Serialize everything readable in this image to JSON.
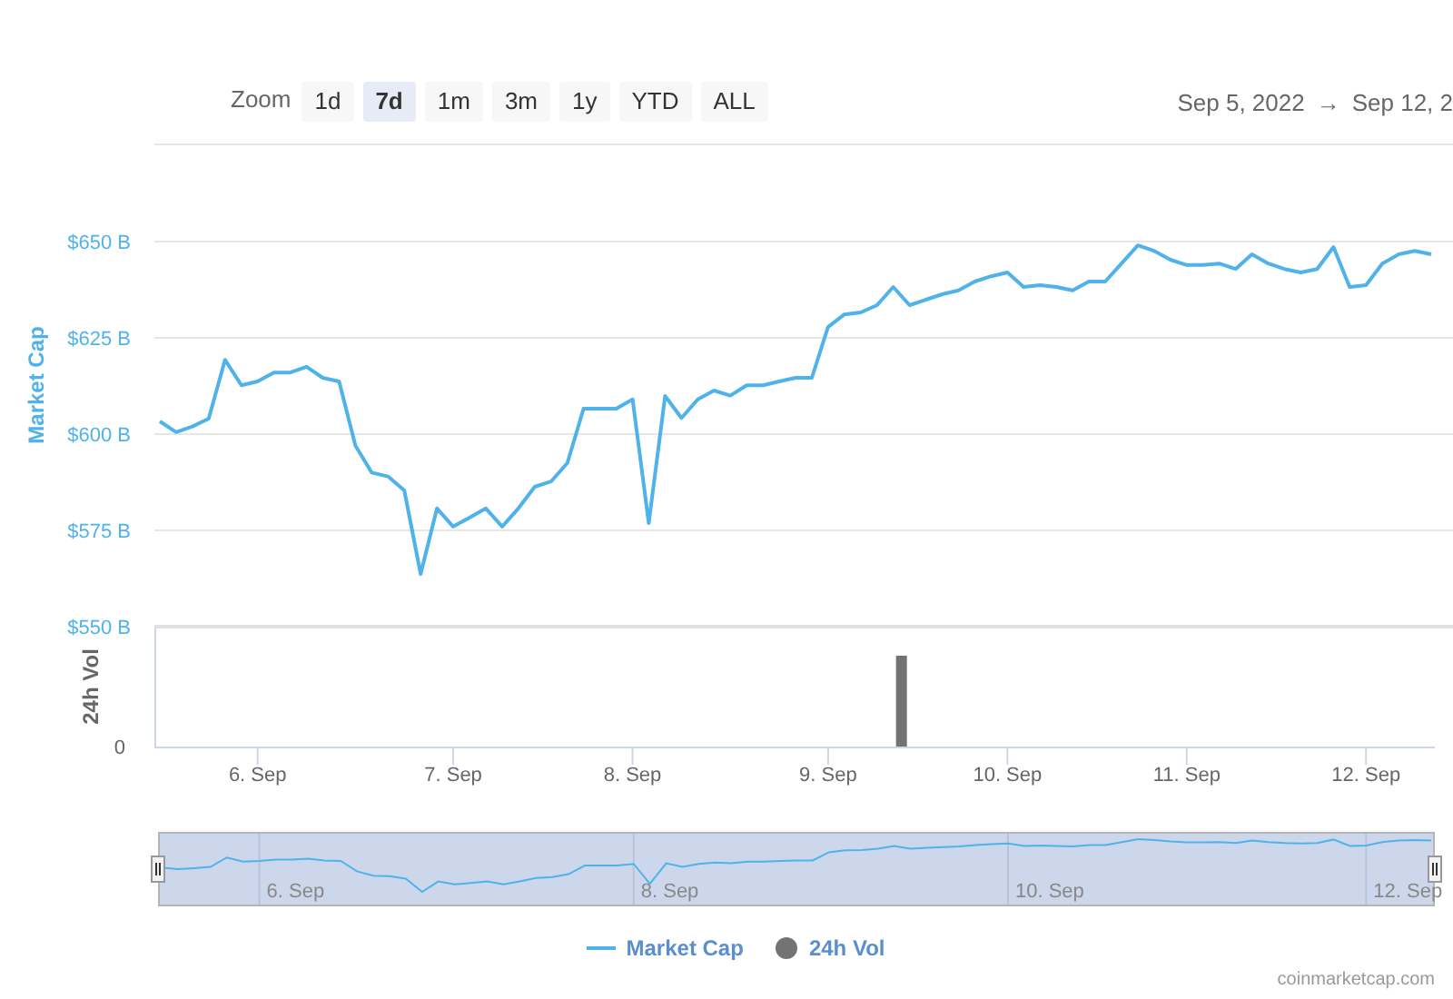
{
  "range_selector": {
    "label": "Zoom",
    "buttons": [
      {
        "label": "1d",
        "selected": false
      },
      {
        "label": "7d",
        "selected": true
      },
      {
        "label": "1m",
        "selected": false
      },
      {
        "label": "3m",
        "selected": false
      },
      {
        "label": "1y",
        "selected": false
      },
      {
        "label": "YTD",
        "selected": false
      },
      {
        "label": "ALL",
        "selected": false
      }
    ]
  },
  "date_range": {
    "from": "Sep 5, 2022",
    "arrow": "→",
    "to": "Sep 12, 2"
  },
  "chart": {
    "chart_data": {
      "type": "line",
      "grid": true,
      "ylabel": "Market Cap",
      "ylim": [
        550,
        650
      ],
      "categories": [
        null,
        null,
        null,
        null,
        null,
        null,
        "6. Sep",
        null,
        null,
        null,
        null,
        null,
        null,
        null,
        null,
        null,
        null,
        null,
        "7. Sep",
        null,
        null,
        null,
        null,
        null,
        null,
        null,
        null,
        null,
        null,
        "8. Sep",
        null,
        null,
        null,
        null,
        null,
        null,
        null,
        null,
        null,
        null,
        null,
        "9. Sep",
        null,
        null,
        null,
        null,
        null,
        null,
        null,
        null,
        null,
        null,
        "10. Sep",
        null,
        null,
        null,
        null,
        null,
        null,
        null,
        null,
        null,
        null,
        "11. Sep",
        null,
        null,
        null,
        null,
        null,
        null,
        null,
        null,
        null,
        null,
        "12. Sep",
        null,
        null,
        null,
        null
      ],
      "yticks": [
        {
          "value": 550,
          "label": "$550 B"
        },
        {
          "value": 575,
          "label": "$575 B"
        },
        {
          "value": 600,
          "label": "$600 B"
        },
        {
          "value": 625,
          "label": "$625 B"
        },
        {
          "value": 650,
          "label": "$650 B"
        }
      ],
      "series": [
        {
          "name": "Market Cap",
          "color": "#4fb3ea",
          "values": [
            603.3,
            600.5,
            602,
            604,
            619.3,
            612.7,
            613.7,
            616,
            616,
            617.5,
            614.6,
            613.7,
            597,
            590,
            589,
            585.4,
            563.7,
            580.7,
            576,
            578.3,
            580.7,
            576,
            580.7,
            586.3,
            587.7,
            592.5,
            606.6,
            606.6,
            606.6,
            609,
            576.9,
            609.9,
            604.2,
            609,
            611.3,
            610,
            612.7,
            612.7,
            613.7,
            614.6,
            614.6,
            627.8,
            631.1,
            631.6,
            633.5,
            638.2,
            633.5,
            634.9,
            636.3,
            637.3,
            639.6,
            641,
            642,
            638.2,
            638.7,
            638.2,
            637.3,
            639.6,
            639.6,
            644.3,
            649,
            647.6,
            645.3,
            643.9,
            643.9,
            644.3,
            642.9,
            646.7,
            644.3,
            642.9,
            642,
            642.9,
            648.6,
            638.2,
            638.7,
            644.3,
            646.7,
            647.6,
            646.7
          ]
        }
      ]
    },
    "volume_axis": {
      "title": "24h Vol",
      "tick": "0"
    }
  },
  "navigator": {
    "labels": [
      "6. Sep",
      "8. Sep",
      "10. Sep",
      "12. Sep"
    ]
  },
  "legend": [
    {
      "kind": "line"
    },
    {
      "label": "24h Vol",
      "kind": "dot",
      "color": "#737373"
    }
  ],
  "credit": "coinmarketcap.com"
}
